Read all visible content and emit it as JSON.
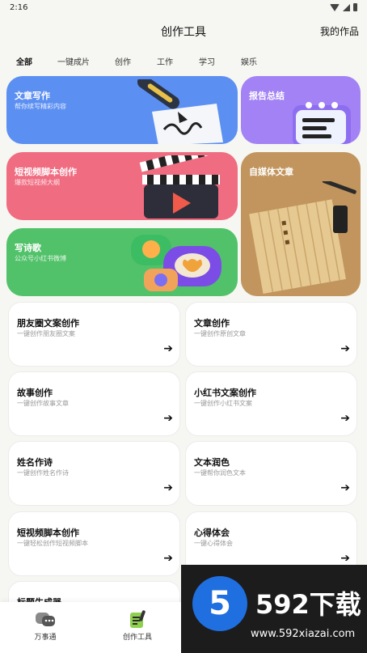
{
  "status_bar": {
    "time": "2:16"
  },
  "header": {
    "title": "创作工具",
    "action": "我的作品"
  },
  "tabs": [
    {
      "label": "全部",
      "active": true
    },
    {
      "label": "一键成片",
      "active": false
    },
    {
      "label": "创作",
      "active": false
    },
    {
      "label": "工作",
      "active": false
    },
    {
      "label": "学习",
      "active": false
    },
    {
      "label": "娱乐",
      "active": false
    }
  ],
  "feature_cards": {
    "article": {
      "title": "文章写作",
      "subtitle": "帮你续写精彩内容",
      "color": "#5b8ff2"
    },
    "report": {
      "title": "报告总结",
      "color": "#a382f5"
    },
    "video_script": {
      "title": "短视频脚本创作",
      "subtitle": "爆款短视频大纲",
      "color": "#f06c80"
    },
    "self_media": {
      "title": "自媒体文章",
      "color": "#c1955d"
    },
    "poem": {
      "title": "写诗歌",
      "subtitle": "公众号小红书微博",
      "color": "#52c26a"
    }
  },
  "tools": [
    {
      "title": "朋友圈文案创作",
      "subtitle": "一键创作朋友圈文案"
    },
    {
      "title": "文章创作",
      "subtitle": "一键创作原创文章"
    },
    {
      "title": "故事创作",
      "subtitle": "一键创作故事文章"
    },
    {
      "title": "小红书文案创作",
      "subtitle": "一键创作小红书文案"
    },
    {
      "title": "姓名作诗",
      "subtitle": "一键创作姓名作诗"
    },
    {
      "title": "文本润色",
      "subtitle": "一键帮你润色文本"
    },
    {
      "title": "短视频脚本创作",
      "subtitle": "一键轻松创作短视频脚本"
    },
    {
      "title": "心得体会",
      "subtitle": "一键心得体会"
    },
    {
      "title": "标题生成器",
      "subtitle": ""
    }
  ],
  "arrow_glyph": "➔",
  "bottom_nav": [
    {
      "label": "万事通",
      "icon": "chat-bubbles-icon",
      "active": false
    },
    {
      "label": "创作工具",
      "icon": "notepad-pen-icon",
      "active": true
    }
  ],
  "watermark": {
    "badge": "5",
    "logo": "592下载",
    "url": "www.592xiazai.com"
  }
}
